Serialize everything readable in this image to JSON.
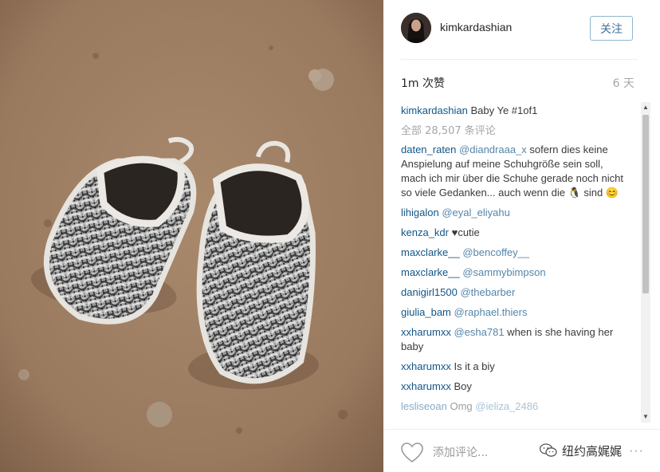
{
  "post": {
    "image_alt": "Baby sneakers on a concrete floor",
    "username": "kimkardashian",
    "follow_label": "关注",
    "likes": "1m 次赞",
    "time_ago": "6 天"
  },
  "caption": {
    "username": "kimkardashian",
    "text": "Baby Ye #1of1"
  },
  "view_all": "全部 28,507 条评论",
  "comments": [
    {
      "user": "daten_raten",
      "mention": "@diandraaa_x",
      "text": " sofern dies keine Anspielung auf meine Schuhgröße sein soll, mach ich mir über die Schuhe gerade noch nicht so viele Gedanken... auch wenn die 🐧 sind 😊"
    },
    {
      "user": "lihigalon",
      "mention": "@eyal_eliyahu",
      "text": ""
    },
    {
      "user": "kenza_kdr",
      "mention": "",
      "text": "♥cutie"
    },
    {
      "user": "maxclarke__",
      "mention": "@bencoffey__",
      "text": ""
    },
    {
      "user": "maxclarke__",
      "mention": "@sammybimpson",
      "text": ""
    },
    {
      "user": "danigirl1500",
      "mention": "@thebarber",
      "text": ""
    },
    {
      "user": "giulia_bam",
      "mention": "@raphael.thiers",
      "text": ""
    },
    {
      "user": "xxharumxx",
      "mention": "@esha781",
      "text": " when is she having her baby"
    },
    {
      "user": "xxharumxx",
      "mention": "",
      "text": "Is it a biy"
    },
    {
      "user": "xxharumxx",
      "mention": "",
      "text": "Boy"
    },
    {
      "user": "lesliseoan",
      "mention": "@ieliza_2486",
      "text": "Omg"
    }
  ],
  "footer": {
    "add_comment_placeholder": "添加评论...",
    "more_label": "···",
    "watermark_text": "纽约高娓娓"
  },
  "icons": {
    "heart": "heart-icon",
    "more": "more-options-icon",
    "scroll_up": "scroll-up-arrow",
    "scroll_down": "scroll-down-arrow",
    "watermark": "wechat-icon"
  },
  "colors": {
    "username_blue": "#125688",
    "follow_blue": "#3f729b",
    "muted_gray": "#a5a7aa"
  }
}
